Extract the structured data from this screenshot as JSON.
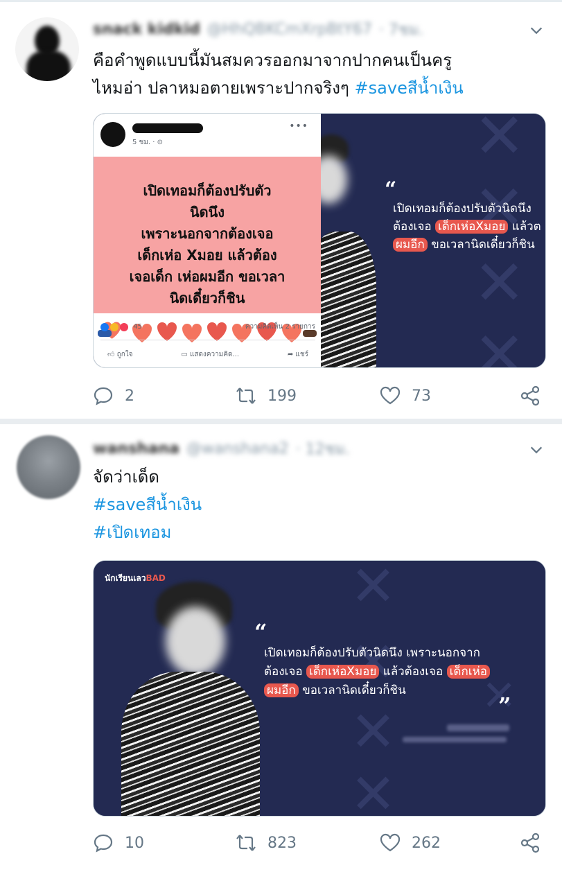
{
  "tweets": [
    {
      "author_name": "snack kidkid",
      "handle": "@HhQBKCmXrpBtY67",
      "time": "· 7ชม.",
      "text_lines": [
        "คือคำพูดแบบนี้มันสมควรออกมาจากปากคนเป็นครู",
        "ไหมอ่า ปลาหมอตายเพราะปากจริงๆ "
      ],
      "hashtags": [
        "#saveสีน้ำเงิน"
      ],
      "media": {
        "fb_time": "5 ชม. · ⊙",
        "fb_post_lines": [
          "เปิดเทอมก็ต้องปรับตัว",
          "นิดนึง",
          "เพราะนอกจากต้องเจอ",
          "เด็กเห่อ  Xมอย แล้วต้อง",
          "เจอเด็ก เห่อผมอีก ขอเวลา",
          "นิดเดี๋ยวก็ชิน"
        ],
        "fb_reactions": "45",
        "fb_comments": "ความคิดเห็น 2 รายการ",
        "fb_like": "ถูกใจ",
        "fb_comment": "แสดงความคิด...",
        "fb_share": "แชร์",
        "quote_open": "“",
        "quote_l1": "เปิดเทอมก็ต้องปรับตัวนิดนึง",
        "quote_l2a": "ต้องเจอ ",
        "quote_l2hl": "เด็กเห่อXมอย",
        "quote_l2b": " แล้วต",
        "quote_l3hl": "ผมอีก",
        "quote_l3b": " ขอเวลานิดเดี๋ยวก็ชิน"
      },
      "stats": {
        "replies": "2",
        "retweets": "199",
        "likes": "73"
      }
    },
    {
      "author_name": "wanshana",
      "handle": "@wanshana2",
      "time": "· 12ชม.",
      "text_lines": [
        "จัดว่าเด็ด"
      ],
      "hashtags": [
        "#saveสีน้ำเงิน",
        "#เปิดเทอม"
      ],
      "media": {
        "logo": "นักเรียนเลว",
        "logo_sub": "BAD",
        "quote_open": "“",
        "quote_close": "”",
        "quote_l1": "เปิดเทอมก็ต้องปรับตัวนิดนึง เพราะนอกจาก",
        "quote_l2a": "ต้องเจอ ",
        "quote_l2hl": "เด็กเห่อXมอย",
        "quote_l2b": " แล้วต้องเจอ ",
        "quote_l2hl2": "เด็กเห่อ",
        "quote_l3hl": "ผมอีก",
        "quote_l3b": " ขอเวลานิดเดี๋ยวก็ชิน"
      },
      "stats": {
        "replies": "10",
        "retweets": "823",
        "likes": "262"
      }
    }
  ],
  "colors": {
    "hashtag": "#1b95e0",
    "panel": "#232a52",
    "highlight": "#e8584e",
    "action_gray": "#657786"
  },
  "icons": [
    "chevron-down-icon",
    "reply-icon",
    "retweet-icon",
    "like-icon",
    "share-icon"
  ]
}
